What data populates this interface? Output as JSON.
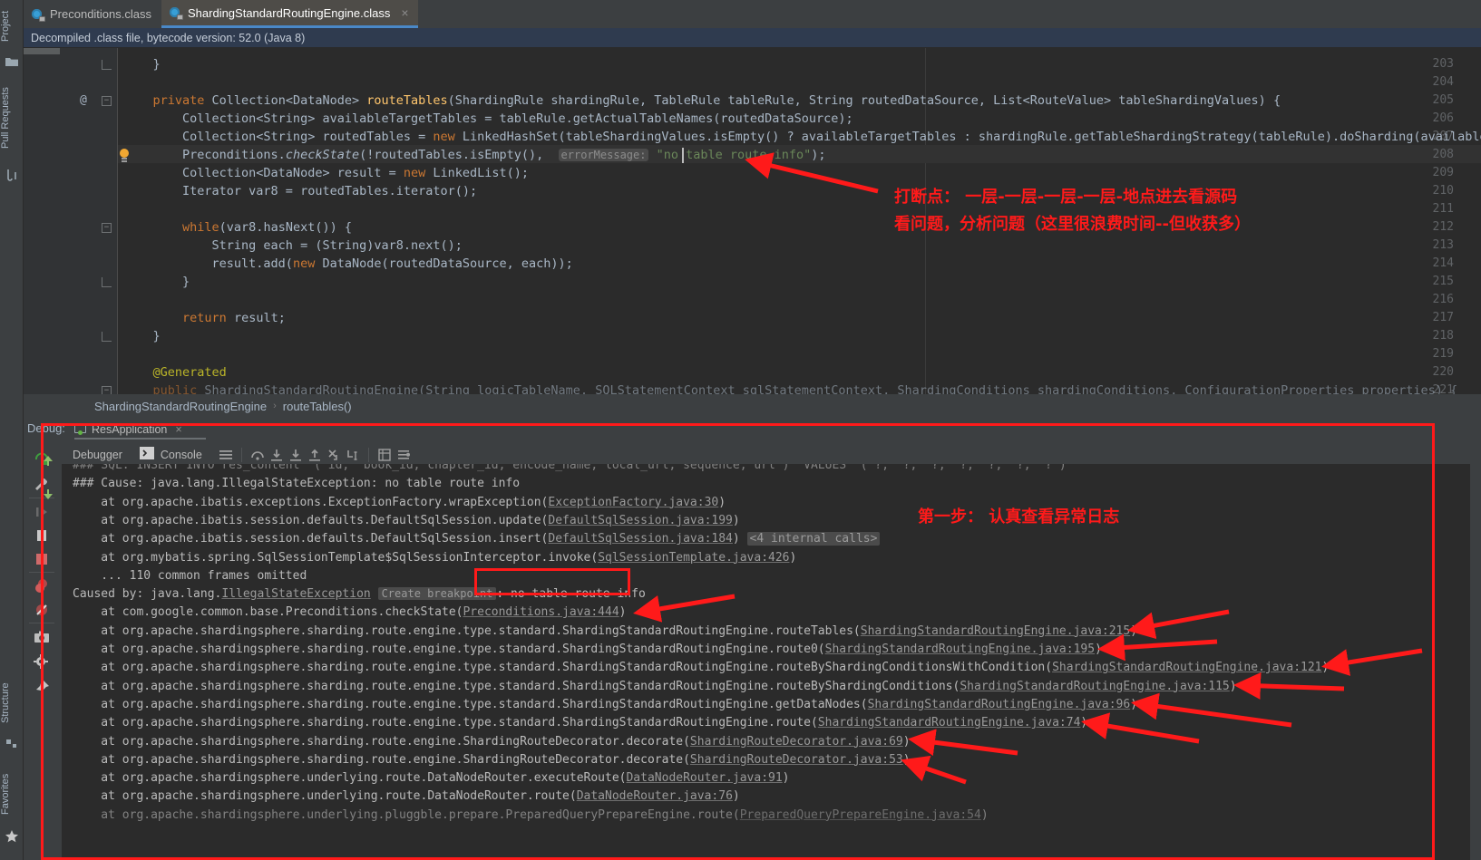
{
  "window": {
    "left_rail": {
      "top_labels": [
        "Project",
        "Pull Requests"
      ],
      "bottom_labels": [
        "Structure",
        "Favorites"
      ]
    }
  },
  "tabs": [
    {
      "label": "Preconditions.class",
      "icon": "java-class-icon",
      "active": false,
      "close": "×"
    },
    {
      "label": "ShardingStandardRoutingEngine.class",
      "icon": "java-class-icon",
      "active": true,
      "close": "×"
    }
  ],
  "notification": {
    "text": "Decompiled .class file, bytecode version: 52.0 (Java 8)"
  },
  "editor": {
    "lines": [
      {
        "no": "203",
        "indent": 0,
        "html": "    }",
        "fold": "minus-end"
      },
      {
        "no": "204",
        "indent": 0,
        "html": ""
      },
      {
        "no": "205",
        "indent": 0,
        "at": "@",
        "fold": "minus",
        "html": "    <span class=\"kw\">private</span> Collection&lt;DataNode&gt; <span class=\"mtd\">routeTables</span>(ShardingRule shardingRule, TableRule tableRule, String routedDataSource, List&lt;RouteValue&gt; tableShardingValues) {"
      },
      {
        "no": "206",
        "html": "        Collection&lt;String&gt; availableTargetTables = tableRule.getActualTableNames(routedDataSource);"
      },
      {
        "no": "207",
        "html": "        Collection&lt;String&gt; routedTables = <span class=\"kw\">new</span> LinkedHashSet(tableShardingValues.isEmpty() ? availableTargetTables : shardingRule.getTableShardingStrategy(tableRule).doSharding(availableTarget"
      },
      {
        "no": "208",
        "bulb": true,
        "highlight": true,
        "html": "        Preconditions.<span class=\"ital\">checkState</span>(!routedTables.isEmpty(),  <span class=\"hint\">errorMessage:</span> <span class=\"str\">\"no table route info\"</span>);"
      },
      {
        "no": "209",
        "html": "        Collection&lt;DataNode&gt; result = <span class=\"kw\">new</span> LinkedList();"
      },
      {
        "no": "210",
        "html": "        Iterator var8 = routedTables.iterator();"
      },
      {
        "no": "211",
        "html": ""
      },
      {
        "no": "212",
        "fold": "minus",
        "html": "        <span class=\"kw\">while</span>(var8.hasNext()) {"
      },
      {
        "no": "213",
        "html": "            String each = (String)var8.next();"
      },
      {
        "no": "214",
        "html": "            result.add(<span class=\"kw\">new</span> DataNode(routedDataSource, each));"
      },
      {
        "no": "215",
        "fold": "minus-end",
        "html": "        }"
      },
      {
        "no": "216",
        "html": ""
      },
      {
        "no": "217",
        "html": "        <span class=\"kw\">return</span> result;"
      },
      {
        "no": "218",
        "fold": "minus-end",
        "html": "    }"
      },
      {
        "no": "219",
        "html": ""
      },
      {
        "no": "220",
        "html": "    <span class=\"ann\">@Generated</span>"
      },
      {
        "no": "221",
        "fold": "minus",
        "clipped": true,
        "html": "    <span class=\"kw\">public</span> ShardingStandardRoutingEngine(String logicTableName, SQLStatementContext sqlStatementContext, ShardingConditions shardingConditions, ConfigurationProperties properties) {"
      }
    ]
  },
  "breadcrumb": {
    "items": [
      "ShardingStandardRoutingEngine",
      "routeTables()"
    ],
    "separator": "›"
  },
  "debug": {
    "panel_label": "Debug:",
    "run_tab": "ResApplication",
    "run_tab_close": "×",
    "tabs": [
      {
        "label": "Debugger",
        "icon": "debugger-icon"
      },
      {
        "label": "Console",
        "icon": "console-icon"
      }
    ],
    "toolbar_icons": [
      "layout-icon",
      "force-step-over-icon",
      "step-over-icon",
      "step-into-icon",
      "step-out-icon",
      "drop-frame-icon",
      "run-to-cursor-icon",
      "evaluate-icon",
      "settings-list-icon"
    ],
    "left_toolbar_icons": [
      "rerun-icon",
      "edit-configurations-icon",
      "resume-icon",
      "pause-icon",
      "stop-icon",
      "view-breakpoints-icon",
      "mute-breakpoints-icon",
      "screenshot-icon",
      "settings-gear-icon",
      "pin-icon"
    ]
  },
  "console": {
    "lines": [
      {
        "clipped": true,
        "html": "### SQL: INSERT INTO res_content  ( id,  book_id, chapter_id, encode_name, local_url, sequence, url )  VALUES  ( ?,  ?,  ?,  ?,  ?,  ?,  ? )"
      },
      {
        "html": "### Cause: java.lang.IllegalStateException: no table route info"
      },
      {
        "html": "    at org.apache.ibatis.exceptions.ExceptionFactory.wrapException(<span class=\"lnk\">ExceptionFactory.java:30</span>)"
      },
      {
        "html": "    at org.apache.ibatis.session.defaults.DefaultSqlSession.update(<span class=\"lnk\">DefaultSqlSession.java:199</span>)"
      },
      {
        "html": "    at org.apache.ibatis.session.defaults.DefaultSqlSession.insert(<span class=\"lnk\">DefaultSqlSession.java:184</span>) <span class=\"internal\">&lt;4 internal calls&gt;</span>"
      },
      {
        "html": "    at org.mybatis.spring.SqlSessionTemplate$SqlSessionInterceptor.invoke(<span class=\"lnk\">SqlSessionTemplate.java:426</span>)"
      },
      {
        "html": "    ... 110 common frames omitted"
      },
      {
        "html": "Caused by: java.lang.<span class=\"lnk\">IllegalStateException</span> <span class=\"mkbp\">Create breakpoint</span>: no table route info"
      },
      {
        "html": "    at com.google.common.base.Preconditions.checkState(<span class=\"lnk\">Preconditions.java:444</span>)"
      },
      {
        "html": "    at org.apache.shardingsphere.sharding.route.engine.type.standard.ShardingStandardRoutingEngine.routeTables(<span class=\"lnk\">ShardingStandardRoutingEngine.java:215</span>)"
      },
      {
        "html": "    at org.apache.shardingsphere.sharding.route.engine.type.standard.ShardingStandardRoutingEngine.route0(<span class=\"lnk\">ShardingStandardRoutingEngine.java:195</span>)"
      },
      {
        "html": "    at org.apache.shardingsphere.sharding.route.engine.type.standard.ShardingStandardRoutingEngine.routeByShardingConditionsWithCondition(<span class=\"lnk\">ShardingStandardRoutingEngine.java:121</span>)"
      },
      {
        "html": "    at org.apache.shardingsphere.sharding.route.engine.type.standard.ShardingStandardRoutingEngine.routeByShardingConditions(<span class=\"lnk\">ShardingStandardRoutingEngine.java:115</span>)"
      },
      {
        "html": "    at org.apache.shardingsphere.sharding.route.engine.type.standard.ShardingStandardRoutingEngine.getDataNodes(<span class=\"lnk\">ShardingStandardRoutingEngine.java:96</span>)"
      },
      {
        "html": "    at org.apache.shardingsphere.sharding.route.engine.type.standard.ShardingStandardRoutingEngine.route(<span class=\"lnk\">ShardingStandardRoutingEngine.java:74</span>)"
      },
      {
        "html": "    at org.apache.shardingsphere.sharding.route.engine.ShardingRouteDecorator.decorate(<span class=\"lnk\">ShardingRouteDecorator.java:69</span>)"
      },
      {
        "html": "    at org.apache.shardingsphere.sharding.route.engine.ShardingRouteDecorator.decorate(<span class=\"lnk\">ShardingRouteDecorator.java:53</span>)"
      },
      {
        "html": "    at org.apache.shardingsphere.underlying.route.DataNodeRouter.executeRoute(<span class=\"lnk\">DataNodeRouter.java:91</span>)"
      },
      {
        "html": "    at org.apache.shardingsphere.underlying.route.DataNodeRouter.route(<span class=\"lnk\">DataNodeRouter.java:76</span>)"
      },
      {
        "clipped": true,
        "html": "    at org.apache.shardingsphere.underlying.pluggble.prepare.PreparedQueryPrepareEngine.route(<span class=\"lnk\">PreparedQueryPrepareEngine.java:54</span>)"
      }
    ]
  },
  "annotations": {
    "color": "#ff1a1a",
    "editor_note_line1": "打断点： 一层-一层-一层-一层-地点进去看源码",
    "editor_note_line2": "看问题，分析问题（这里很浪费时间--但收获多）",
    "console_note": "第一步： 认真查看异常日志"
  }
}
